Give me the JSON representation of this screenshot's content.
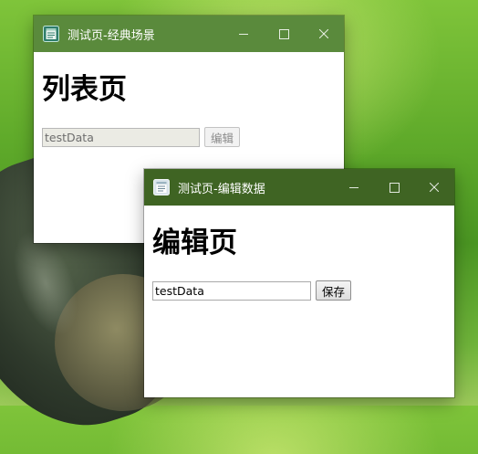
{
  "desktop": {
    "wallpaper_colors": [
      "#7fc43a",
      "#4a9522",
      "#2f3a2c"
    ]
  },
  "list_window": {
    "title": "测试页-经典场景",
    "heading": "列表页",
    "field": {
      "value": "testData",
      "disabled": true
    },
    "edit_button": {
      "label": "编辑",
      "disabled": true
    },
    "titlebar_color": "#5a8a3c",
    "icon": "notepad-icon"
  },
  "edit_window": {
    "title": "测试页-编辑数据",
    "heading": "编辑页",
    "field": {
      "value": "testData",
      "disabled": false
    },
    "save_button": {
      "label": "保存",
      "disabled": false
    },
    "titlebar_color": "#3f6423",
    "icon": "notepad-icon"
  },
  "window_controls": {
    "minimize": "minimize-icon",
    "maximize": "maximize-icon",
    "close": "close-icon"
  }
}
